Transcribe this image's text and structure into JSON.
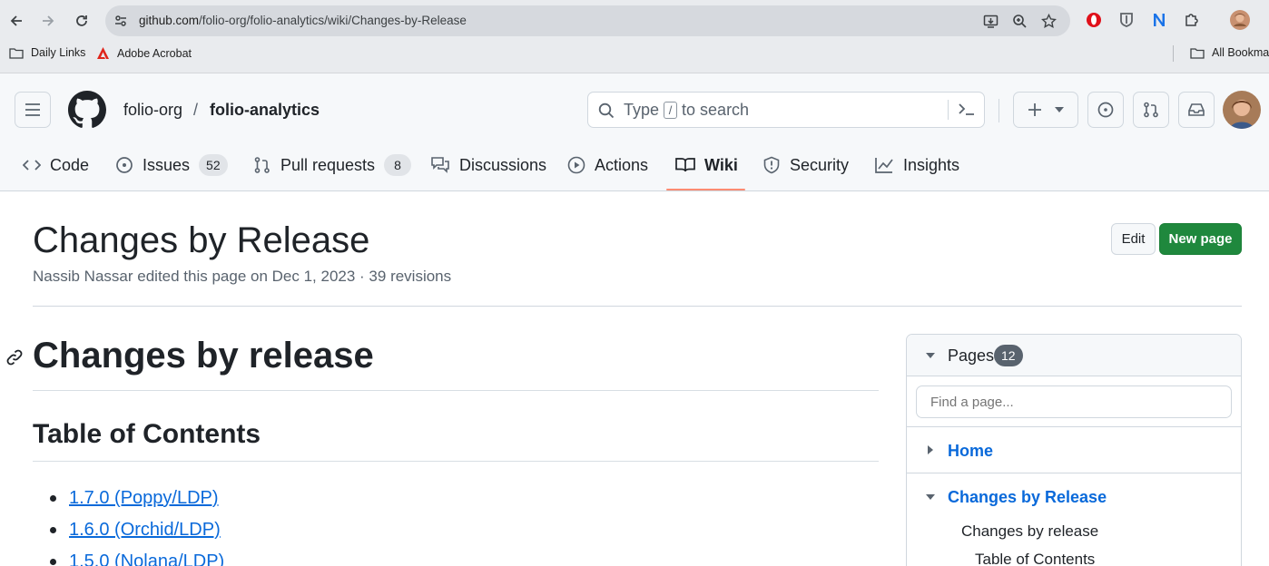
{
  "browser": {
    "url_domain": "github.com",
    "url_path": "/folio-org/folio-analytics/wiki/Changes-by-Release",
    "bookmarks": [
      "Daily Links",
      "Adobe Acrobat"
    ],
    "all_bookmarks": "All Bookmar"
  },
  "header": {
    "owner": "folio-org",
    "separator": "/",
    "repo": "folio-analytics",
    "search_prefix": "Type",
    "search_key": "/",
    "search_suffix": "to search"
  },
  "tabs": [
    {
      "label": "Code"
    },
    {
      "label": "Issues",
      "count": "52"
    },
    {
      "label": "Pull requests",
      "count": "8"
    },
    {
      "label": "Discussions"
    },
    {
      "label": "Actions"
    },
    {
      "label": "Wiki"
    },
    {
      "label": "Security"
    },
    {
      "label": "Insights"
    }
  ],
  "page": {
    "title": "Changes by Release",
    "meta": "Nassib Nassar edited this page on Dec 1, 2023 · 39 revisions",
    "edit_label": "Edit",
    "new_page_label": "New page"
  },
  "content": {
    "h1": "Changes by release",
    "h2": "Table of Contents",
    "toc": [
      "1.7.0 (Poppy/LDP)",
      "1.6.0 (Orchid/LDP)",
      "1.5.0 (Nolana/LDP)"
    ]
  },
  "sidebar": {
    "pages_label": "Pages",
    "pages_count": "12",
    "find_placeholder": "Find a page...",
    "items": [
      "Home",
      "Changes by Release"
    ],
    "subitems": [
      "Changes by release",
      "Table of Contents"
    ]
  },
  "colors": {
    "accent_tab": "#fd8c73",
    "link": "#0969da",
    "primary_button": "#1f883d"
  }
}
